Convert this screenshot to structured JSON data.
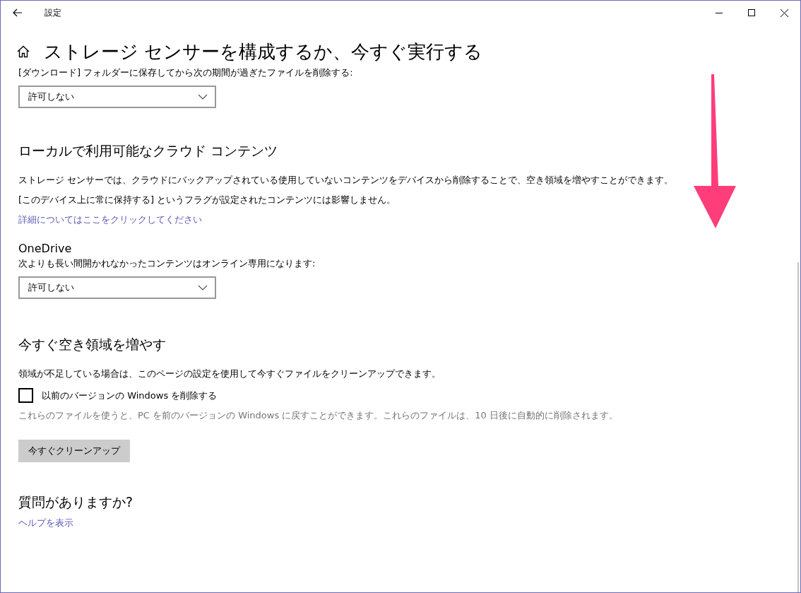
{
  "window": {
    "title": "設定"
  },
  "page": {
    "title": "ストレージ センサーを構成するか、今すぐ実行する"
  },
  "downloads": {
    "label": "[ダウンロード] フォルダーに保存してから次の期間が過ぎたファイルを削除する:",
    "dropdown": {
      "value": "許可しない"
    }
  },
  "cloud": {
    "heading": "ローカルで利用可能なクラウド コンテンツ",
    "paragraphs": [
      "ストレージ センサーでは、クラウドにバックアップされている使用していないコンテンツをデバイスから削除することで、空き領域を増やすことができます。",
      "[このデバイス上に常に保持する] というフラグが設定されたコンテンツには影響しません。"
    ],
    "link": "詳細についてはここをクリックしてください",
    "onedrive": {
      "title": "OneDrive",
      "label": "次よりも長い間開かれなかったコンテンツはオンライン専用になります:",
      "dropdown": {
        "value": "許可しない"
      }
    }
  },
  "free_space": {
    "heading": "今すぐ空き領域を増やす",
    "description": "領域が不足している場合は、このページの設定を使用して今すぐファイルをクリーンアップできます。",
    "checkbox": {
      "label": "以前のバージョンの Windows を削除する",
      "checked": false
    },
    "note": "これらのファイルを使うと、PC を前のバージョンの Windows に戻すことができます。これらのファイルは、10 日後に自動的に削除されます。",
    "button": "今すぐクリーンアップ"
  },
  "help": {
    "heading": "質問がありますか?",
    "link": "ヘルプを表示"
  }
}
